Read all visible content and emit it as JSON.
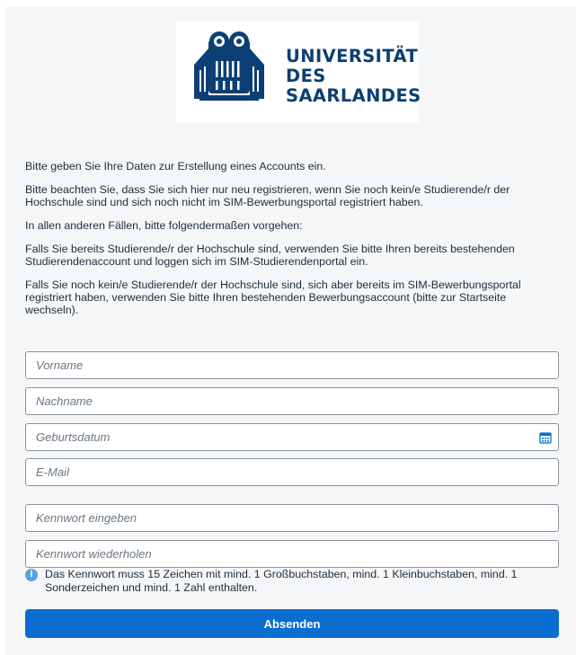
{
  "logo": {
    "lines": [
      "UNIVERSITÄT",
      "DES",
      "SAARLANDES"
    ]
  },
  "intro": {
    "paragraphs": [
      "Bitte geben Sie Ihre Daten zur Erstellung eines Accounts ein.",
      "Bitte beachten Sie, dass Sie sich hier nur neu registrieren, wenn Sie noch kein/e Studierende/r der Hochschule sind und sich noch nicht im SIM-Bewerbungsportal registriert haben.",
      "In allen anderen Fällen, bitte folgendermaßen vorgehen:",
      "Falls Sie bereits Studierende/r der Hochschule sind, verwenden Sie bitte Ihren bereits bestehenden Studierendenaccount und loggen sich im SIM-Studierendenportal ein.",
      "Falls Sie noch kein/e Studierende/r der Hochschule sind, sich aber bereits im SIM-Bewerbungsportal registriert haben, verwenden Sie bitte Ihren bestehenden Bewerbungsaccount (bitte zur Startseite wechseln)."
    ]
  },
  "form": {
    "first_name": {
      "placeholder": "Vorname",
      "value": ""
    },
    "last_name": {
      "placeholder": "Nachname",
      "value": ""
    },
    "birth_date": {
      "placeholder": "Geburtsdatum",
      "value": ""
    },
    "email": {
      "placeholder": "E-Mail",
      "value": ""
    },
    "password": {
      "placeholder": "Kennwort eingeben",
      "value": ""
    },
    "password_repeat": {
      "placeholder": "Kennwort wiederholen",
      "value": ""
    },
    "password_hint": "Das Kennwort muss 15 Zeichen mit mind. 1 Großbuchstaben, mind. 1 Kleinbuchstaben, mind. 1 Sonderzeichen und mind. 1 Zahl enthalten.",
    "submit_label": "Absenden"
  },
  "icons": {
    "calendar": "calendar-icon",
    "info": "info-icon",
    "logo": "owl-logo-icon"
  },
  "colors": {
    "logo_blue": "#0c3f73",
    "primary_button": "#0a6ed1",
    "info_icon": "#5b9ee6",
    "field_border": "#89919a",
    "panel_background": "#f5f6f7"
  }
}
